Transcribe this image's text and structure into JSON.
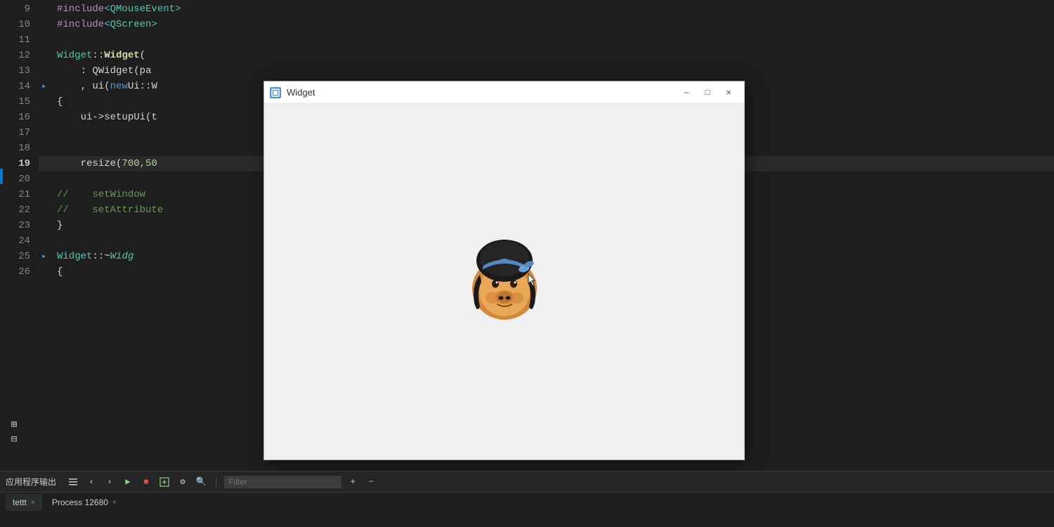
{
  "editor": {
    "background": "#1e1e1e",
    "lines": [
      {
        "num": 9,
        "content": [
          {
            "text": "#include",
            "class": "c-magenta"
          },
          {
            "text": "<QMouseEvent>",
            "class": "c-green-text"
          }
        ],
        "arrow": false,
        "highlighted": false
      },
      {
        "num": 10,
        "content": [
          {
            "text": "#include",
            "class": "c-magenta"
          },
          {
            "text": "<QScreen>",
            "class": "c-green-text"
          }
        ],
        "arrow": false,
        "highlighted": false
      },
      {
        "num": 11,
        "content": [],
        "arrow": false,
        "highlighted": false
      },
      {
        "num": 12,
        "content": [
          {
            "text": "Widget",
            "class": "c-namespace"
          },
          {
            "text": "::",
            "class": "c-punct"
          },
          {
            "text": "Widget",
            "class": "c-function"
          },
          {
            "text": "(",
            "class": "c-punct"
          }
        ],
        "arrow": false,
        "highlighted": false
      },
      {
        "num": 13,
        "content": [
          {
            "text": "    : QWidget(pa",
            "class": "c-white"
          }
        ],
        "arrow": false,
        "highlighted": false
      },
      {
        "num": 14,
        "content": [
          {
            "text": "    , ui(",
            "class": "c-white"
          },
          {
            "text": "new",
            "class": "c-blue"
          },
          {
            "text": " Ui::W",
            "class": "c-white"
          }
        ],
        "arrow": true,
        "highlighted": false
      },
      {
        "num": 15,
        "content": [
          {
            "text": "{",
            "class": "c-punct"
          }
        ],
        "arrow": false,
        "highlighted": false
      },
      {
        "num": 16,
        "content": [
          {
            "text": "    ui->setupUi(t",
            "class": "c-white"
          }
        ],
        "arrow": false,
        "highlighted": false
      },
      {
        "num": 17,
        "content": [],
        "arrow": false,
        "highlighted": false
      },
      {
        "num": 18,
        "content": [],
        "arrow": false,
        "highlighted": false
      },
      {
        "num": 19,
        "content": [
          {
            "text": "    resize(",
            "class": "c-white"
          },
          {
            "text": "700,50",
            "class": "c-number"
          }
        ],
        "arrow": false,
        "highlighted": true,
        "active": true
      },
      {
        "num": 20,
        "content": [],
        "arrow": false,
        "highlighted": false
      },
      {
        "num": 21,
        "content": [
          {
            "text": "//    setWindow",
            "class": "c-comment"
          }
        ],
        "arrow": false,
        "highlighted": false
      },
      {
        "num": 22,
        "content": [
          {
            "text": "//    setAttribute",
            "class": "c-comment"
          }
        ],
        "arrow": false,
        "highlighted": false
      },
      {
        "num": 23,
        "content": [
          {
            "text": "}",
            "class": "c-punct"
          }
        ],
        "arrow": false,
        "highlighted": false
      },
      {
        "num": 24,
        "content": [],
        "arrow": false,
        "highlighted": false
      },
      {
        "num": 25,
        "content": [
          {
            "text": "Widget",
            "class": "c-namespace"
          },
          {
            "text": "::~",
            "class": "c-punct"
          },
          {
            "text": "Widg",
            "class": "c-destructor"
          }
        ],
        "arrow": true,
        "highlighted": false
      },
      {
        "num": 26,
        "content": [
          {
            "text": "{",
            "class": "c-punct"
          }
        ],
        "arrow": false,
        "highlighted": false
      }
    ]
  },
  "bottom_panel": {
    "title": "应用程序输出",
    "filter_placeholder": "Filter",
    "tabs": [
      {
        "label": "tettt",
        "active": true
      },
      {
        "label": "Process 12680",
        "active": false
      }
    ],
    "toolbar_buttons": [
      {
        "icon": "≡",
        "label": "menu-icon"
      },
      {
        "icon": "‹",
        "label": "prev-icon"
      },
      {
        "icon": "›",
        "label": "next-icon"
      },
      {
        "icon": "▶",
        "label": "run-icon"
      },
      {
        "icon": "■",
        "label": "stop-icon",
        "color": "red"
      },
      {
        "icon": "⊞",
        "label": "add-icon"
      },
      {
        "icon": "⚙",
        "label": "settings-icon"
      },
      {
        "icon": "🔍",
        "label": "filter-icon"
      },
      {
        "icon": "+",
        "label": "plus-icon"
      },
      {
        "icon": "−",
        "label": "minus-icon"
      }
    ]
  },
  "widget_window": {
    "title": "Widget",
    "icon": "□",
    "controls": {
      "minimize": "—",
      "maximize": "□",
      "close": "✕"
    }
  },
  "side_buttons": {
    "expand": "⊞",
    "collapse": "⊟"
  }
}
